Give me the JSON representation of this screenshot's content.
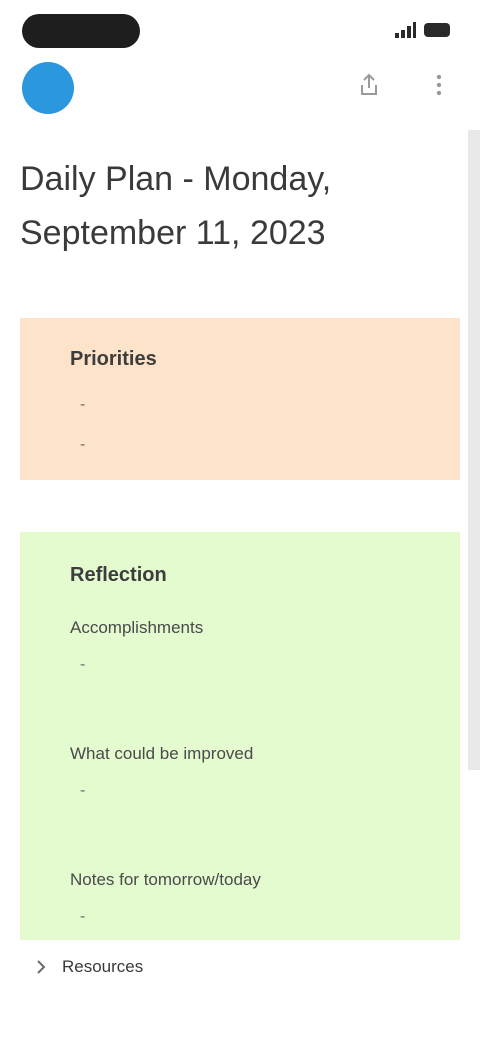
{
  "status_bar": {
    "icons": [
      "signal-icon",
      "battery-icon"
    ]
  },
  "app_bar": {
    "avatar_color": "#2b97de",
    "icons": [
      "share-icon",
      "more-icon"
    ]
  },
  "page": {
    "title": "Daily Plan - Monday, September 11, 2023"
  },
  "priorities_card": {
    "background": "#fde3c9",
    "heading": "Priorities",
    "items": [
      "-",
      "-"
    ]
  },
  "reflection_card": {
    "background": "#e4fbd0",
    "heading": "Reflection",
    "fields": [
      {
        "label": "Accomplishments",
        "value": "-"
      },
      {
        "label": "What could be improved",
        "value": "-"
      },
      {
        "label": "Notes for tomorrow/today",
        "value": "-"
      }
    ]
  },
  "footer": {
    "label": "Resources"
  }
}
